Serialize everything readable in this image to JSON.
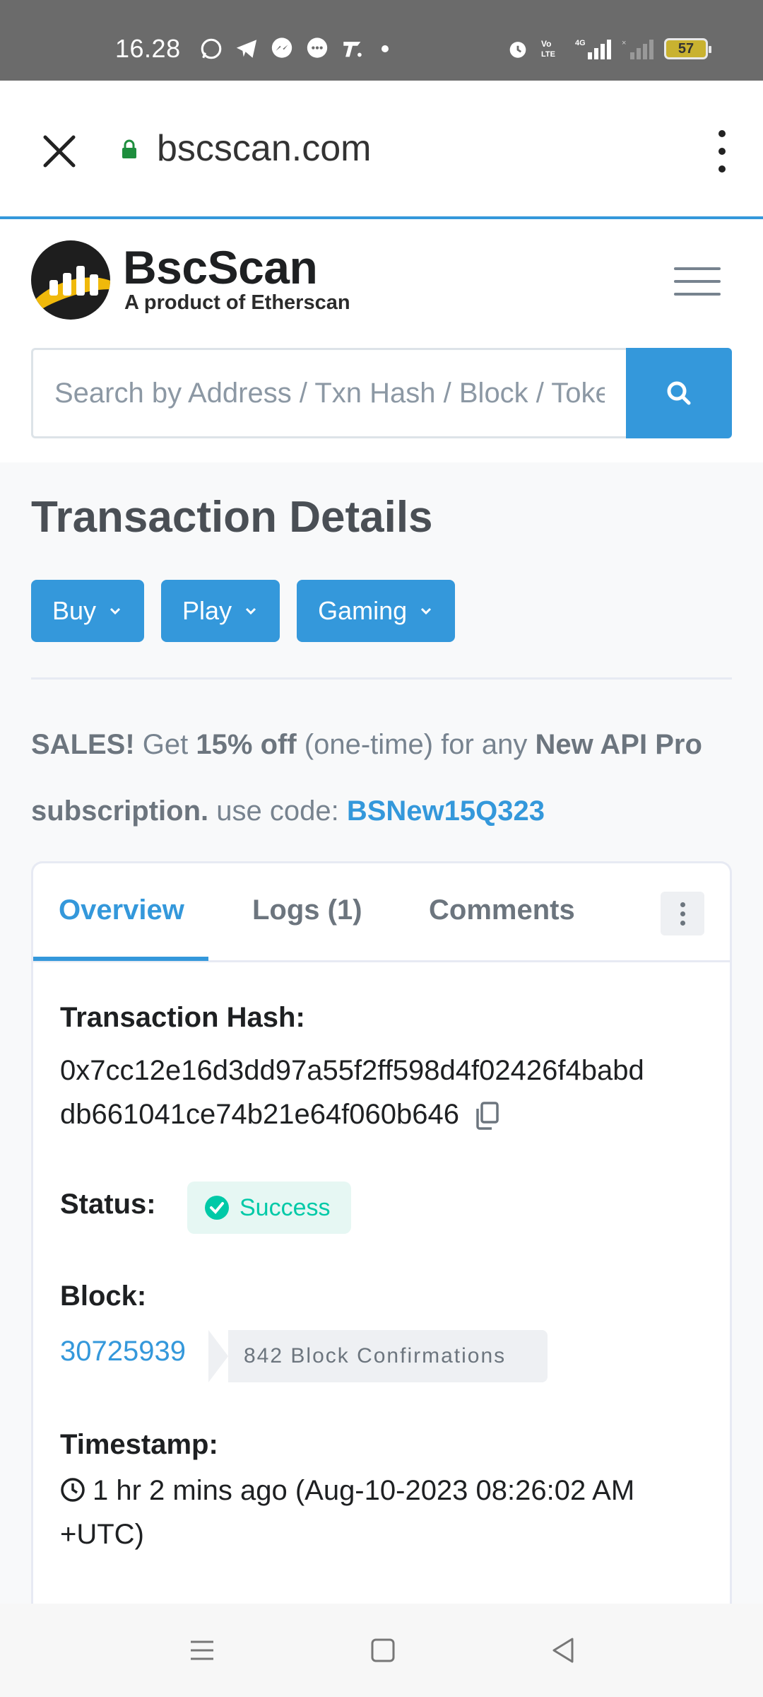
{
  "status_bar": {
    "time": "16.28",
    "battery": "57",
    "left_icons": [
      "whatsapp-icon",
      "telegram-icon",
      "messenger-icon",
      "chat-icon",
      "app-icon"
    ],
    "right_icons": [
      "alarm-icon",
      "volte-icon",
      "4g-signal-icon",
      "no-signal-icon",
      "battery-icon"
    ]
  },
  "browser": {
    "url": "bscscan.com"
  },
  "site": {
    "brand": "BscScan",
    "tagline": "A product of Etherscan",
    "search_placeholder": "Search by Address / Txn Hash / Block / Token"
  },
  "page": {
    "title": "Transaction Details",
    "buttons": [
      "Buy",
      "Play",
      "Gaming"
    ]
  },
  "promo": {
    "sales": "SALES!",
    "get": " Get ",
    "discount": "15% off",
    "one_time": " (one-time) for any ",
    "product": "New API Pro subscription.",
    "use_code": " use code: ",
    "code": "BSNew15Q323"
  },
  "tabs": {
    "overview": "Overview",
    "logs": "Logs (1)",
    "comments": "Comments"
  },
  "details": {
    "hash_label": "Transaction Hash:",
    "hash_line1": "0x7cc12e16d3dd97a55f2ff598d4f02426f4babd",
    "hash_line2": "db661041ce74b21e64f060b646",
    "status_label": "Status:",
    "status_value": "Success",
    "block_label": "Block:",
    "block_number": "30725939",
    "block_confirmations": "842 Block Confirmations",
    "timestamp_label": "Timestamp:",
    "timestamp_line1": "1 hr 2 mins ago (Aug-10-2023 08:26:02 AM",
    "timestamp_line2": "+UTC)"
  },
  "colors": {
    "accent": "#3498db",
    "success": "#00c9a7",
    "brand_gold": "#f0b90b"
  }
}
